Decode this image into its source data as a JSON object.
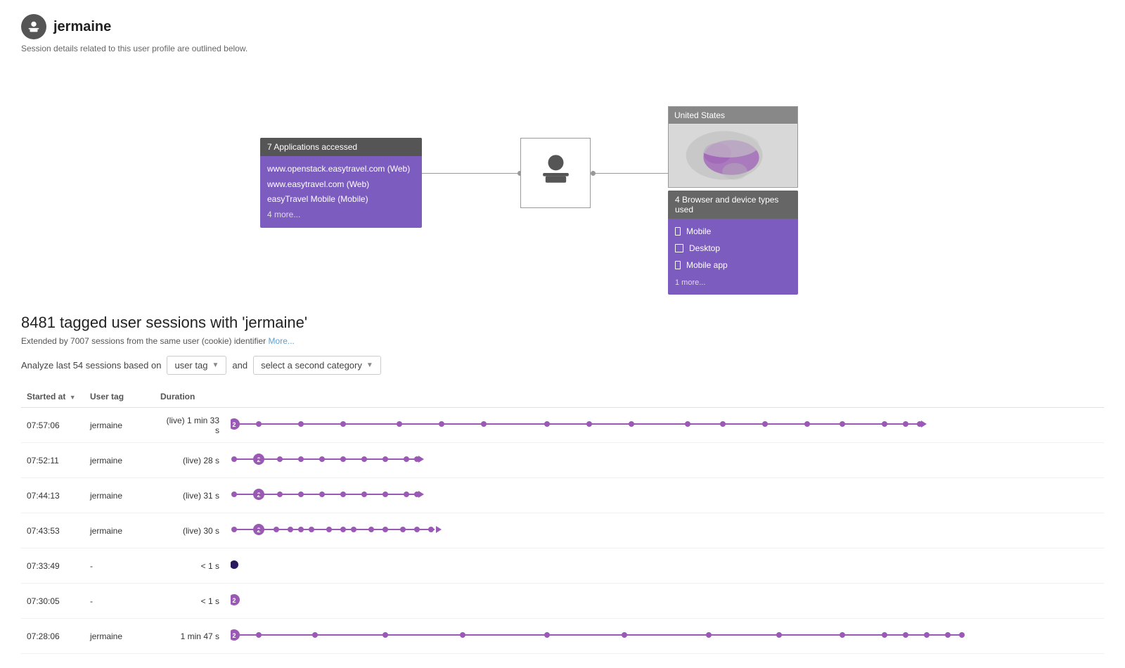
{
  "user": {
    "name": "jermaine",
    "subtitle": "Session details related to this user profile are outlined below."
  },
  "diagram": {
    "apps_header": "7 Applications accessed",
    "apps": [
      "www.openstack.easytravel.com (Web)",
      "www.easytravel.com (Web)",
      "easyTravel Mobile (Mobile)"
    ],
    "apps_more": "4 more...",
    "location_header": "United States",
    "devices_header": "4 Browser and device types used",
    "devices": [
      {
        "icon": "mobile",
        "label": "Mobile"
      },
      {
        "icon": "desktop",
        "label": "Desktop"
      },
      {
        "icon": "mobile-app",
        "label": "Mobile app"
      }
    ],
    "devices_more": "1 more..."
  },
  "sessions": {
    "title": "8481 tagged user sessions with 'jermaine'",
    "subtitle": "Extended by 7007 sessions from the same user (cookie) identifier",
    "more_link": "More...",
    "analyze_text": "Analyze last 54 sessions based on",
    "dropdown1_value": "user tag",
    "dropdown2_placeholder": "select a second category",
    "and_text": "and"
  },
  "table": {
    "headers": [
      {
        "label": "Started at",
        "sortable": true,
        "sort_dir": "▼"
      },
      {
        "label": "User tag",
        "sortable": false
      },
      {
        "label": "Duration",
        "sortable": false
      }
    ],
    "rows": [
      {
        "started": "07:57:06",
        "tag": "jermaine",
        "duration": "(live) 1 min 33 s",
        "timeline_type": "long"
      },
      {
        "started": "07:52:11",
        "tag": "jermaine",
        "duration": "(live) 28 s",
        "timeline_type": "medium"
      },
      {
        "started": "07:44:13",
        "tag": "jermaine",
        "duration": "(live) 31 s",
        "timeline_type": "medium"
      },
      {
        "started": "07:43:53",
        "tag": "jermaine",
        "duration": "(live) 30 s",
        "timeline_type": "medium-short"
      },
      {
        "started": "07:33:49",
        "tag": "-",
        "duration": "< 1 s",
        "timeline_type": "dot-only"
      },
      {
        "started": "07:30:05",
        "tag": "-",
        "duration": "< 1 s",
        "timeline_type": "dot-numbered"
      },
      {
        "started": "07:28:06",
        "tag": "jermaine",
        "duration": "1 min 47 s",
        "timeline_type": "very-long"
      }
    ]
  }
}
